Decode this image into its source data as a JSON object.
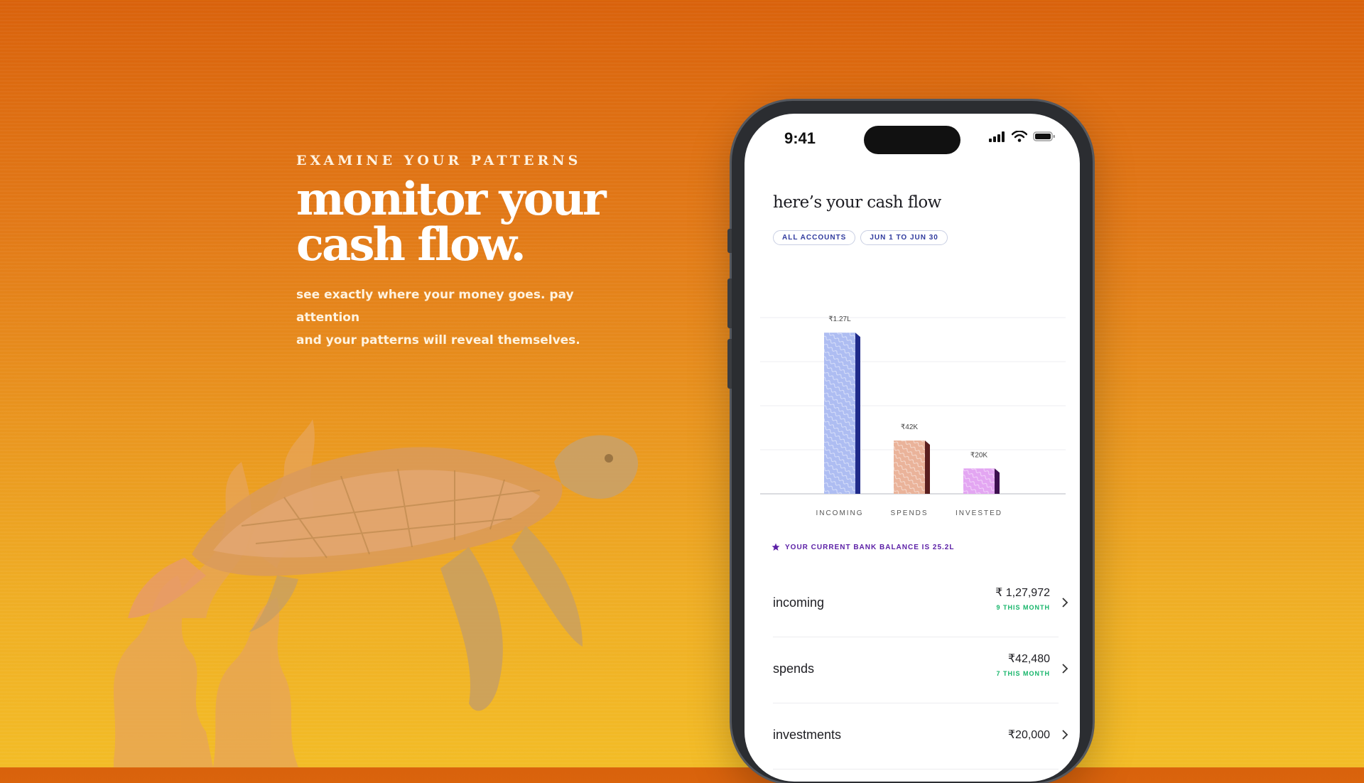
{
  "hero": {
    "eyebrow": "EXAMINE YOUR PATTERNS",
    "headline_line1": "monitor your",
    "headline_line2": "cash flow.",
    "sub_line1": "see exactly where your money goes. pay attention",
    "sub_line2": "and your patterns will reveal themselves."
  },
  "phone": {
    "time": "9:41",
    "title": "here’s your cash flow",
    "chips": [
      "ALL ACCOUNTS",
      "JUN 1 TO JUN 30"
    ],
    "balance_text": "YOUR CURRENT BANK BALANCE IS 25.2L",
    "rows": [
      {
        "label": "incoming",
        "amount": "₹ 1,27,972",
        "sub": "9 THIS MONTH"
      },
      {
        "label": "spends",
        "amount": "₹42,480",
        "sub": "7 THIS MONTH"
      },
      {
        "label": "investments",
        "amount": "₹20,000",
        "sub": ""
      }
    ]
  },
  "chart_data": {
    "type": "bar",
    "categories": [
      "INCOMING",
      "SPENDS",
      "INVESTED"
    ],
    "values": [
      127000,
      42000,
      20000
    ],
    "data_labels": [
      "₹1.27L",
      "₹42K",
      "₹20K"
    ],
    "colors": [
      "#aebdf2",
      "#eab39a",
      "#e3a6f2"
    ],
    "edge_colors": [
      "#1f2a8a",
      "#5a1f1f",
      "#3d1050"
    ],
    "ylim": [
      0,
      140000
    ],
    "grid": true
  },
  "colors": {
    "bg_top": "#d9620c",
    "bg_bottom": "#f3bc26",
    "chip_text": "#2f3a9e",
    "balance_text": "#5b1fa6",
    "positive_green": "#16b56a"
  }
}
